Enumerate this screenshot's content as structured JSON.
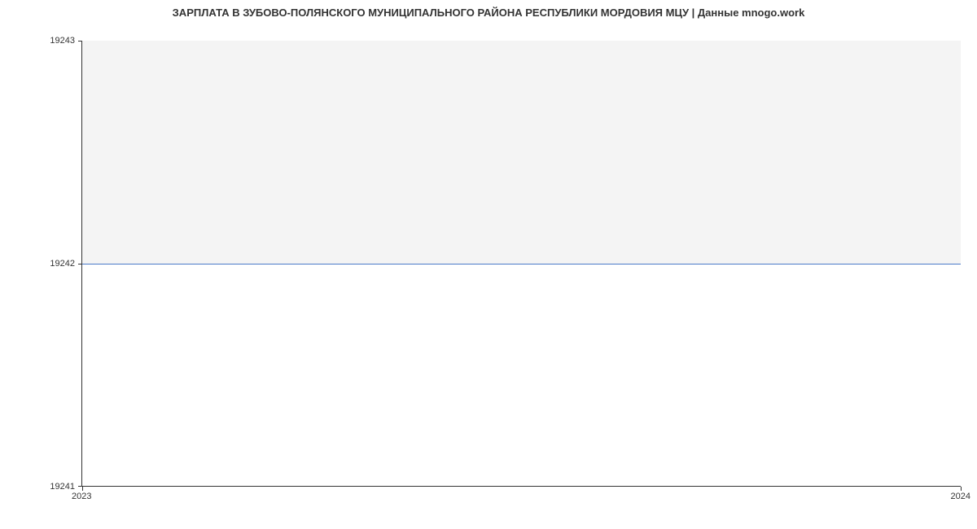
{
  "chart_data": {
    "type": "line",
    "title": "ЗАРПЛАТА В ЗУБОВО-ПОЛЯНСКОГО МУНИЦИПАЛЬНОГО РАЙОНА РЕСПУБЛИКИ МОРДОВИЯ МЦУ | Данные mnogo.work",
    "x": [
      2023,
      2024
    ],
    "values": [
      19242,
      19242
    ],
    "xlabel": "",
    "ylabel": "",
    "ylim": [
      19241,
      19243
    ],
    "y_ticks": [
      19241,
      19242,
      19243
    ],
    "x_ticks": [
      2023,
      2024
    ],
    "line_color": "#4a7bc8",
    "area_fill": true,
    "area_color": "#f4f4f4"
  }
}
